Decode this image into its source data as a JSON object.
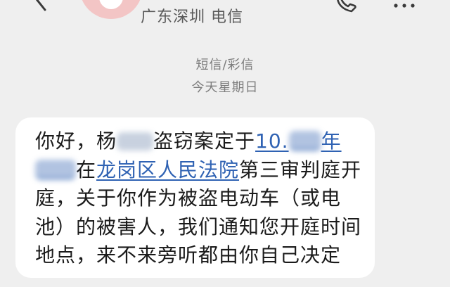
{
  "header": {
    "back_icon": "chevron-left-icon",
    "avatar_icon": "person-icon",
    "contact_name": "广东深圳 电信",
    "call_icon": "phone-icon",
    "menu_icon": "more-horizontal-icon"
  },
  "thread": {
    "channel": "短信/彩信",
    "date": "今天星期日"
  },
  "message": {
    "line1": {
      "part_a": "你好，杨",
      "part_b": "盗窃案定于",
      "link_start": "10.",
      "link_end": "年"
    },
    "line2": {
      "part_a": "在",
      "link": "龙岗区人民法院",
      "part_b": "第三审判庭开"
    },
    "line3": "庭，关于你作为被盗电动车（或电",
    "line4": "池）的被害人，我们通知您开庭时间",
    "line5": "地点，来不来旁听都由你自己决定"
  },
  "colors": {
    "background": "#efefef",
    "bubble": "#ffffff",
    "text": "#1b1b1b",
    "secondary_text": "#7c7c7c",
    "link": "#2f62b3",
    "avatar": "#f3c5c5"
  }
}
